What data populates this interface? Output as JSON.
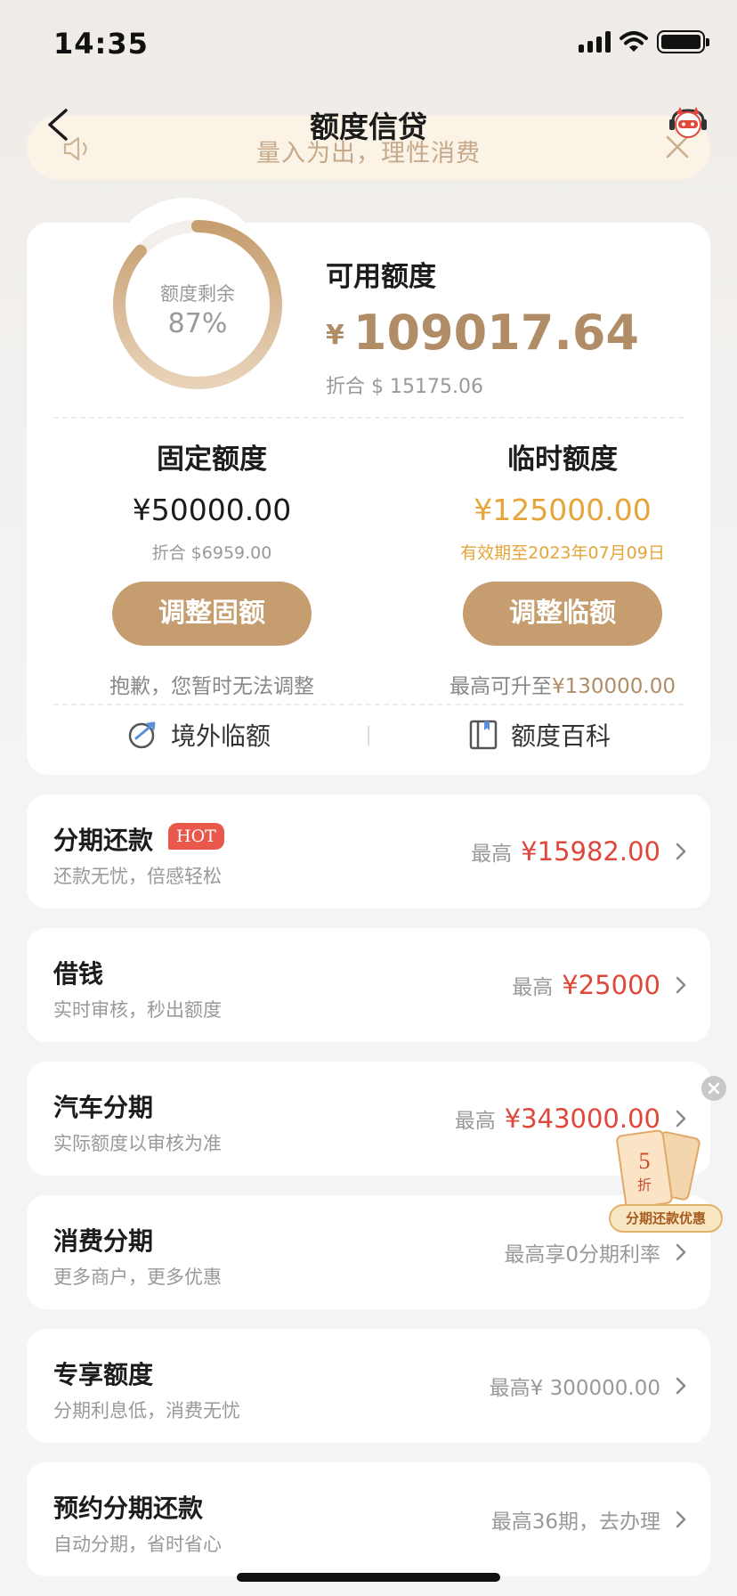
{
  "status_bar": {
    "time": "14:35"
  },
  "nav": {
    "title": "额度信贷"
  },
  "notice": {
    "text": "量入为出，理性消费"
  },
  "quota": {
    "ring_label": "额度剩余",
    "ring_percent_text": "87%",
    "ring_fraction": 0.87,
    "available_title": "可用额度",
    "available_currency": "¥",
    "available_amount": "109017.64",
    "available_usd": "折合 $ 15175.06",
    "fixed": {
      "title": "固定额度",
      "amount": "¥50000.00",
      "sub": "折合 $6959.00",
      "button": "调整固额",
      "note": "抱歉，您暂时无法调整"
    },
    "temp": {
      "title": "临时额度",
      "amount": "¥125000.00",
      "sub": "有效期至2023年07月09日",
      "button": "调整临额",
      "note_prefix": "最高可升至",
      "note_amount": "¥130000.00"
    },
    "links": {
      "overseas": "境外临额",
      "wiki": "额度百科"
    }
  },
  "rows": [
    {
      "title": "分期还款",
      "badge": "HOT",
      "sub": "还款无忧，倍感轻松",
      "prefix": "最高",
      "amount": "¥15982.00"
    },
    {
      "title": "借钱",
      "sub": "实时审核，秒出额度",
      "prefix": "最高",
      "amount": "¥25000"
    },
    {
      "title": "汽车分期",
      "sub": "实际额度以审核为准",
      "prefix": "最高",
      "amount": "¥343000.00"
    },
    {
      "title": "消费分期",
      "sub": "更多商户，更多优惠",
      "text": "最高享0分期利率"
    },
    {
      "title": "专享额度",
      "sub": "分期利息低，消费无忧",
      "text": "最高¥ 300000.00"
    },
    {
      "title": "预约分期还款",
      "sub": "自动分期，省时省心",
      "text": "最高36期，去办理"
    }
  ],
  "promo": {
    "coupon_number": "5",
    "coupon_unit": "折",
    "label": "分期还款优惠"
  },
  "colors": {
    "accent_gold": "#c59d6e",
    "amount_gold": "#b08d66",
    "temp_orange": "#e5a53a",
    "amount_red": "#e0473b"
  }
}
